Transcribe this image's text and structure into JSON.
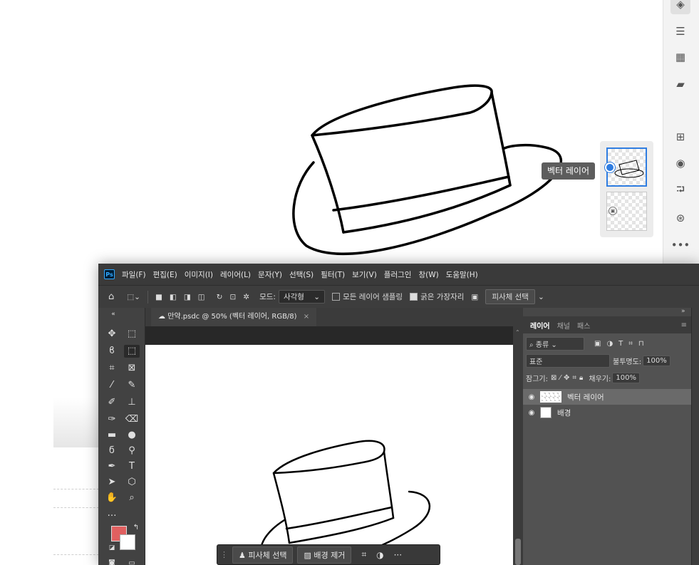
{
  "tooltip": {
    "text": "벡터 레이어"
  },
  "menubar": {
    "logo": "Ps",
    "items": [
      "파일(F)",
      "편집(E)",
      "이미지(I)",
      "레이어(L)",
      "문자(Y)",
      "선택(S)",
      "필터(T)",
      "보기(V)",
      "플러그인",
      "창(W)",
      "도움말(H)"
    ]
  },
  "optionsbar": {
    "mode_label": "모드:",
    "mode_value": "사각형",
    "sample_all_layers": "모든 레이어 샘플링",
    "hard_edge": "굵은 가장자리",
    "subject_select": "피사체 선택"
  },
  "document": {
    "tab_title": "만약.psdc @ 50% (벡터 레이어, RGB/8)",
    "close": "×"
  },
  "context_bar": {
    "select_subject": "피사체 선택",
    "remove_bg": "배경 제거",
    "more": "···"
  },
  "layers_panel": {
    "tabs": [
      "레이어",
      "채널",
      "패스"
    ],
    "filter_kind": "종류",
    "blend_mode": "표준",
    "opacity_label": "불투명도:",
    "opacity_value": "100%",
    "lock_label": "잠그기:",
    "fill_label": "채우기:",
    "fill_value": "100%",
    "layers": [
      {
        "name": "벡터 레이어",
        "selected": true
      },
      {
        "name": "배경",
        "selected": false
      }
    ]
  },
  "colors": {
    "foreground": "#e06060",
    "background": "#ffffff",
    "accent": "#2f7de1"
  }
}
